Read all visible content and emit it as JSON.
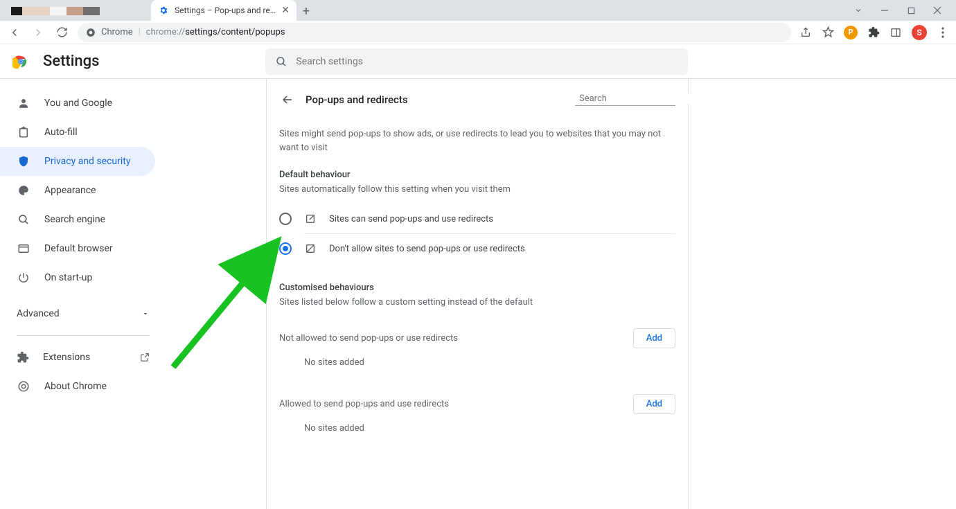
{
  "browser": {
    "active_tab_title": "Settings – Pop-ups and redirects",
    "omnibox_prefix": "Chrome",
    "omnibox_url_dim": "chrome://",
    "omnibox_url_main": "settings/content/popups",
    "avatar_letter": "S"
  },
  "header": {
    "title": "Settings",
    "search_placeholder": "Search settings"
  },
  "sidebar": {
    "items": [
      {
        "label": "You and Google"
      },
      {
        "label": "Auto-fill"
      },
      {
        "label": "Privacy and security"
      },
      {
        "label": "Appearance"
      },
      {
        "label": "Search engine"
      },
      {
        "label": "Default browser"
      },
      {
        "label": "On start-up"
      }
    ],
    "advanced_label": "Advanced",
    "extensions_label": "Extensions",
    "about_label": "About Chrome"
  },
  "page": {
    "back_title": "Pop-ups and redirects",
    "search_placeholder": "Search",
    "intro": "Sites might send pop-ups to show ads, or use redirects to lead you to websites that you may not want to visit",
    "default_behaviour_title": "Default behaviour",
    "default_behaviour_sub": "Sites automatically follow this setting when you visit them",
    "radio_allow": "Sites can send pop-ups and use redirects",
    "radio_block": "Don't allow sites to send pop-ups or use redirects",
    "customised_title": "Customised behaviours",
    "customised_sub": "Sites listed below follow a custom setting instead of the default",
    "not_allowed_label": "Not allowed to send pop-ups or use redirects",
    "allowed_label": "Allowed to send pop-ups and use redirects",
    "add_label": "Add",
    "no_sites": "No sites added"
  }
}
